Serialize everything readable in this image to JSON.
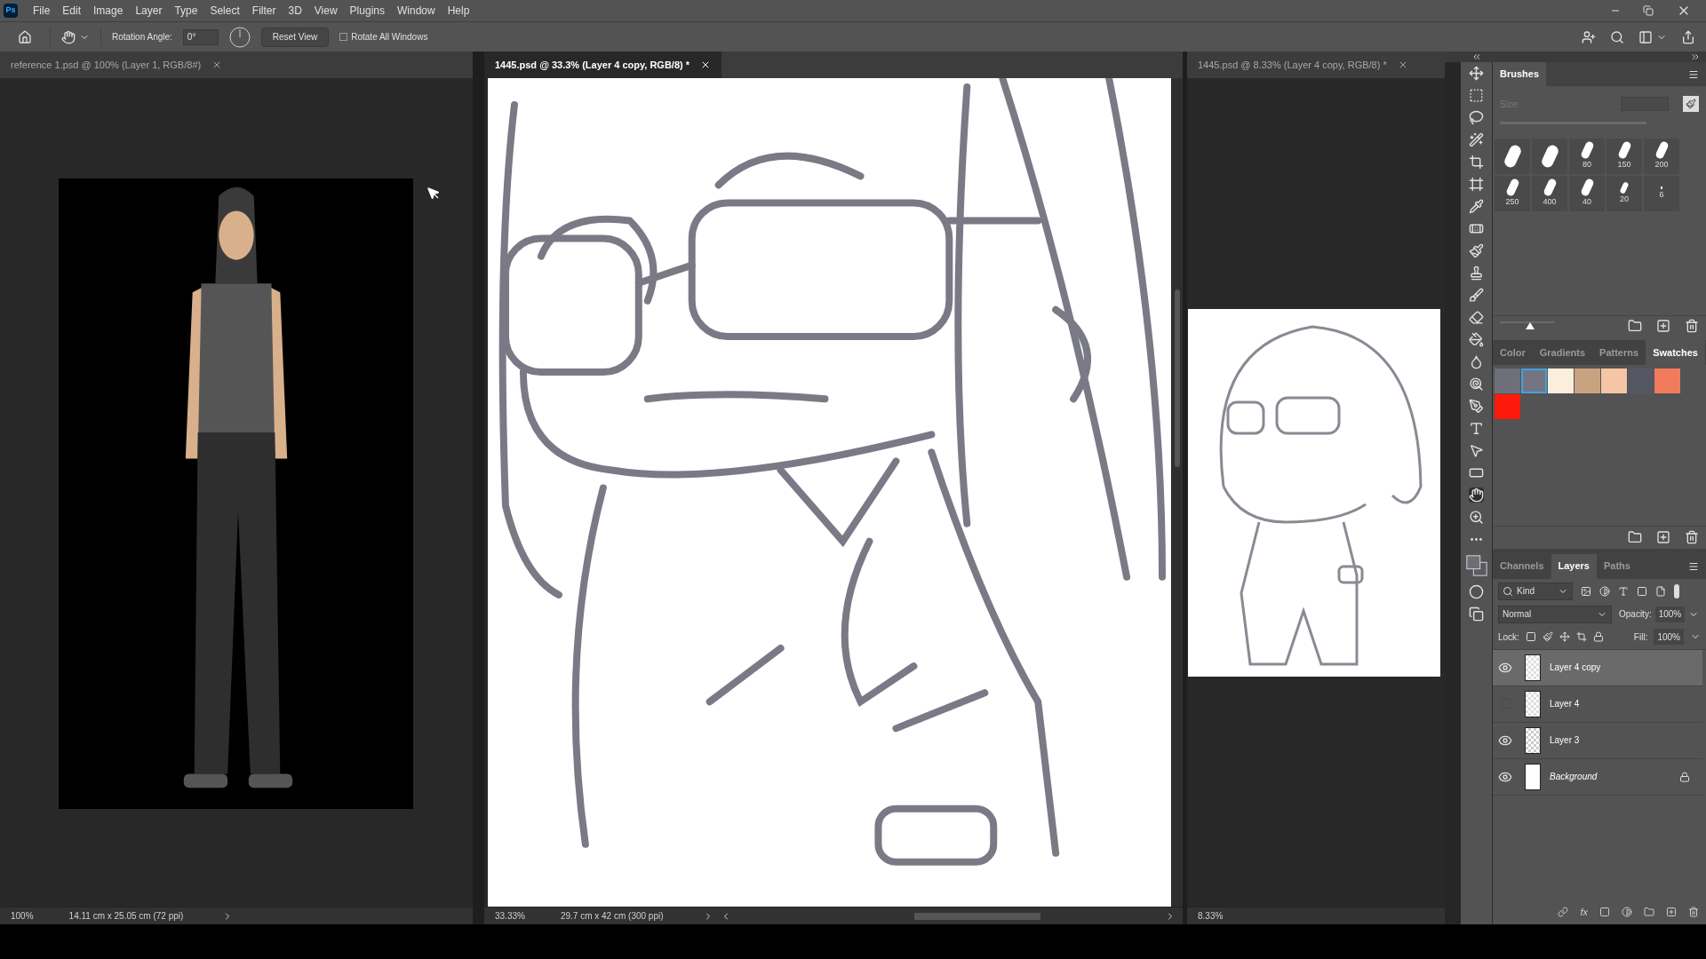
{
  "app": {
    "logo": "Ps",
    "menu": [
      "File",
      "Edit",
      "Image",
      "Layer",
      "Type",
      "Select",
      "Filter",
      "3D",
      "View",
      "Plugins",
      "Window",
      "Help"
    ]
  },
  "options_bar": {
    "rotation_label": "Rotation Angle:",
    "rotation_value": "0°",
    "reset_button": "Reset View",
    "rotate_all": {
      "label": "Rotate All Windows",
      "checked": false
    }
  },
  "documents": [
    {
      "kind": "reference",
      "tab": "reference 1.psd @ 100% (Layer 1, RGB/8#)",
      "selected": false,
      "zoom": "100%",
      "size": "14.11 cm x 25.05 cm (72 ppi)"
    },
    {
      "kind": "sketch",
      "tab": "1445.psd @ 33.3% (Layer 4 copy, RGB/8) *",
      "selected": true,
      "zoom": "33.33%",
      "size": "29.7 cm x 42 cm (300 ppi)"
    },
    {
      "kind": "thumbnail",
      "tab": "1445.psd @ 8.33% (Layer 4 copy, RGB/8) *",
      "selected": false,
      "zoom": "8.33%"
    }
  ],
  "brushes_panel": {
    "title": "Brushes",
    "size_label": "Size:",
    "brushes": [
      {
        "kind": "large"
      },
      {
        "kind": "large"
      },
      {
        "kind": "medium",
        "label": "80"
      },
      {
        "kind": "medium",
        "label": "150"
      },
      {
        "kind": "medium",
        "label": "200"
      },
      {
        "kind": "medium",
        "label": "250"
      },
      {
        "kind": "medium",
        "label": "400"
      },
      {
        "kind": "medium",
        "label": "40"
      },
      {
        "kind": "small",
        "label": "20"
      },
      {
        "kind": "dot",
        "label": "6"
      }
    ],
    "preview_slider": {
      "level": 0.55
    }
  },
  "swatches_panel": {
    "tabs": [
      {
        "label": "Color",
        "selected": false
      },
      {
        "label": "Gradients",
        "selected": false
      },
      {
        "label": "Patterns",
        "selected": false
      },
      {
        "label": "Swatches",
        "selected": true
      }
    ],
    "swatches": [
      {
        "color": "#6e7079",
        "selected": false
      },
      {
        "color": "#747482",
        "selected": true
      },
      {
        "color": "#fbeedd",
        "selected": false
      },
      {
        "color": "#c9a27f",
        "selected": false
      },
      {
        "color": "#f5c5a5",
        "selected": false
      },
      {
        "color": "#555763",
        "selected": false
      },
      {
        "color": "#f27b5d",
        "selected": false
      },
      {
        "color": "#fe1a0a",
        "selected": false
      }
    ]
  },
  "layers_panel": {
    "tabs": [
      {
        "label": "Channels",
        "selected": false
      },
      {
        "label": "Layers",
        "selected": true
      },
      {
        "label": "Paths",
        "selected": false
      }
    ],
    "filter": "Kind",
    "blend_mode": "Normal",
    "opacity_label": "Opacity:",
    "opacity": "100%",
    "lock_label": "Lock:",
    "fill_label": "Fill:",
    "fill": "100%",
    "effects_button": "fx",
    "layers": [
      {
        "name": "Layer 4 copy",
        "kind": "sketch",
        "visible": true,
        "selected": true,
        "locked": false
      },
      {
        "name": "Layer 4",
        "kind": "sketch",
        "visible": false,
        "selected": false,
        "locked": false
      },
      {
        "name": "Layer 3",
        "kind": "transparent",
        "visible": true,
        "selected": false,
        "locked": false
      },
      {
        "name": "Background",
        "kind": "background",
        "visible": true,
        "selected": false,
        "locked": true
      }
    ]
  }
}
